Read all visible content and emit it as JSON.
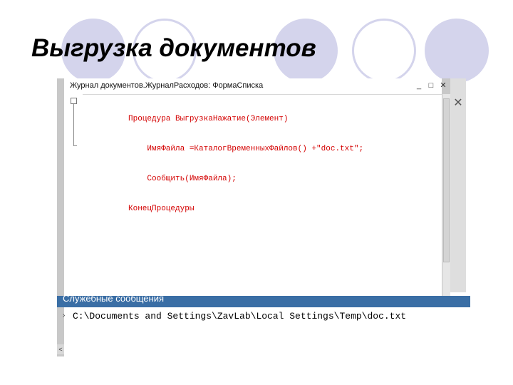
{
  "slide": {
    "title": "Выгрузка документов"
  },
  "window": {
    "title": "Журнал документов.ЖурналРасходов: ФормаСписка",
    "minimize_icon": "_",
    "maximize_icon": "□",
    "close_icon": "✕"
  },
  "code": {
    "lines": [
      "Процедура ВыгрузкаНажатие(Элемент)",
      "    ИмяФайла =КаталогВременныхФайлов() +\"doc.txt\";",
      "    Сообщить(ИмяФайла);",
      "КонецПроцедуры"
    ]
  },
  "side_panel": {
    "close_icon": "✕"
  },
  "messages": {
    "header": "Служебные сообщения",
    "icon": "›",
    "text": "C:\\Documents and Settings\\ZavLab\\Local Settings\\Temp\\doc.txt",
    "scroll_icon": "<"
  },
  "colors": {
    "code_keyword": "#d40000",
    "decor_circle": "#d4d4ec",
    "messages_header": "#3a6ea5"
  }
}
